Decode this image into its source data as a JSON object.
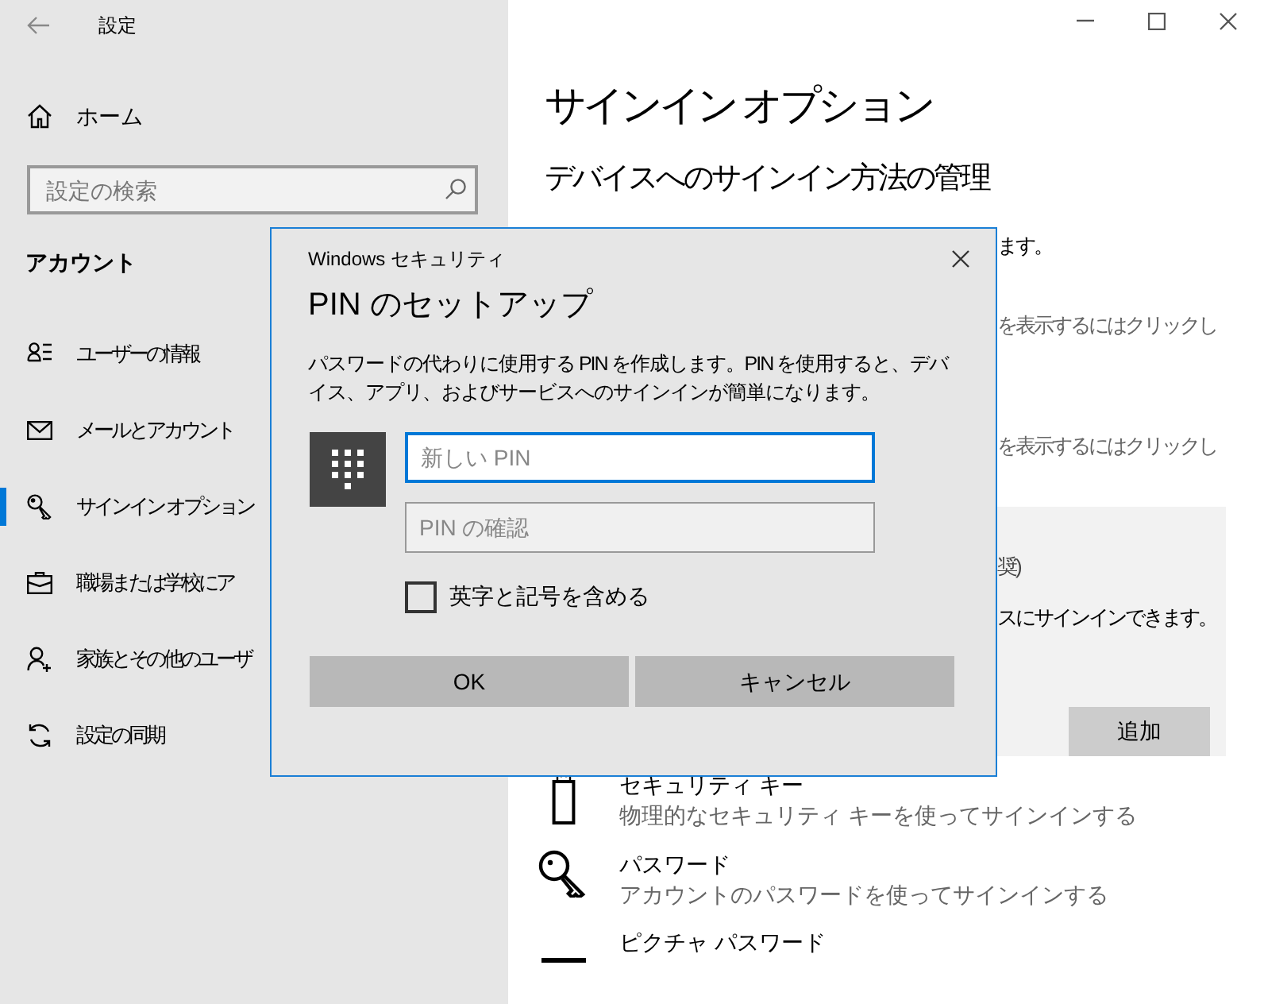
{
  "window": {
    "title": "設定"
  },
  "sidebar": {
    "home": "ホーム",
    "search": {
      "placeholder": "設定の検索"
    },
    "section": "アカウント",
    "items": [
      {
        "label": "ユーザーの情報",
        "selected": false
      },
      {
        "label": "メールとアカウント",
        "selected": false
      },
      {
        "label": "サインイン オプション",
        "selected": true
      },
      {
        "label": "職場または学校にア",
        "selected": false
      },
      {
        "label": "家族とその他のユーザ",
        "selected": false
      },
      {
        "label": "設定の同期",
        "selected": false
      }
    ]
  },
  "main": {
    "title": "サインイン オプション",
    "subtitle": "デバイスへのサインイン方法の管理",
    "fragments": [
      "ます。",
      "を表示するにはクリックし",
      "を表示するにはクリックし"
    ],
    "pin_panel": {
      "lines": [
        "奨)",
        "スにサインインできます。"
      ],
      "button": "追加"
    },
    "options": [
      {
        "title": "セキュリティ キー",
        "description": "物理的なセキュリティ キーを使ってサインインする"
      },
      {
        "title": "パスワード",
        "description": "アカウントのパスワードを使ってサインインする"
      },
      {
        "title": "ピクチャ パスワード"
      }
    ]
  },
  "dialog": {
    "app": "Windows セキュリティ",
    "title": "PIN のセットアップ",
    "description": "パスワードの代わりに使用する PIN を作成します。PIN を使用すると、デバイス、アプリ、およびサービスへのサインインが簡単になります。",
    "fields": [
      {
        "placeholder": "新しい PIN",
        "focused": true
      },
      {
        "placeholder": "PIN の確認",
        "focused": false
      }
    ],
    "checkbox": {
      "label": "英字と記号を含める",
      "checked": false
    },
    "buttons": [
      "OK",
      "キャンセル"
    ]
  }
}
